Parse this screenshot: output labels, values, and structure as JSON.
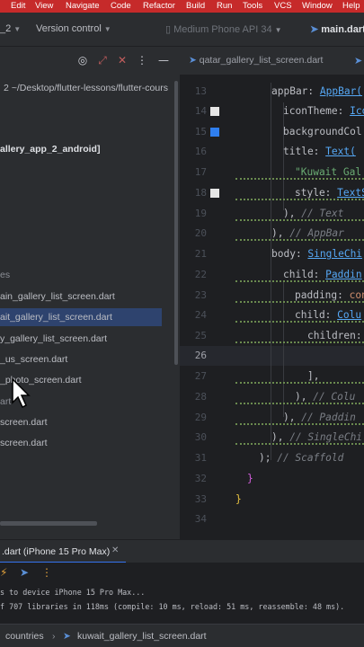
{
  "menubar": {
    "items": [
      "Edit",
      "View",
      "Navigate",
      "Code",
      "Refactor",
      "Build",
      "Run",
      "Tools",
      "VCS",
      "Window",
      "Help"
    ]
  },
  "toolbar": {
    "project_name": "_2",
    "vcs_label": "Version control",
    "device_label": "Medium Phone API 34",
    "run_config": "main.dart"
  },
  "editor_tabs": {
    "active_tab": "qatar_gallery_list_screen.dart"
  },
  "project_tree": {
    "rows": [
      {
        "text": "2  ~/Desktop/flutter-lessons/flutter-cours",
        "style": "normal"
      },
      {
        "text": "allery_app_2_android]",
        "style": "bold"
      },
      {
        "text": "es",
        "style": "muted"
      },
      {
        "text": "ain_gallery_list_screen.dart",
        "style": "normal"
      },
      {
        "text": "ait_gallery_list_screen.dart",
        "style": "selected"
      },
      {
        "text": "y_gallery_list_screen.dart",
        "style": "normal"
      },
      {
        "text": "_us_screen.dart",
        "style": "normal"
      },
      {
        "text": "_photo_screen.dart",
        "style": "normal"
      },
      {
        "text": "art",
        "style": "muted"
      },
      {
        "text": "screen.dart",
        "style": "normal"
      },
      {
        "text": "screen.dart",
        "style": "normal"
      }
    ]
  },
  "editor": {
    "line_numbers": [
      "13",
      "14",
      "15",
      "16",
      "17",
      "18",
      "19",
      "20",
      "21",
      "22",
      "23",
      "24",
      "25",
      "26",
      "27",
      "28",
      "29",
      "30",
      "31",
      "32",
      "33",
      "34"
    ],
    "active_line": "26",
    "code": {
      "l13": {
        "prop": "appBar: ",
        "cls": "AppBar("
      },
      "l14": {
        "prop": "iconTheme: ",
        "cls": "Ico"
      },
      "l15": {
        "prop": "backgroundCol"
      },
      "l16": {
        "prop": "title: ",
        "cls": "Text("
      },
      "l17": {
        "str": "\"Kuwait Gal"
      },
      "l18": {
        "prop": "style: ",
        "cls": "TextS"
      },
      "l19": {
        "pun": "),",
        "cmt": " // Text"
      },
      "l20": {
        "pun": "),",
        "cmt": " // AppBar"
      },
      "l21": {
        "prop": "body: ",
        "cls": "SingleChi"
      },
      "l22": {
        "prop": "child: ",
        "cls": "Paddin"
      },
      "l23": {
        "prop": "padding: ",
        "kw": "con"
      },
      "l24": {
        "prop": "child: ",
        "cls": "Colu"
      },
      "l25": {
        "prop": "children: ["
      },
      "l27": {
        "pun": "],"
      },
      "l28": {
        "pun": "),",
        "cmt": " // Colu"
      },
      "l29": {
        "pun": "),",
        "cmt": " // Paddin"
      },
      "l30": {
        "pun": "),",
        "cmt": " // SingleChi"
      },
      "l31": {
        "pun": ");",
        "cmt": " // Scaffold"
      },
      "l32": {
        "pun": "}"
      },
      "l33": {
        "pun": "}"
      }
    }
  },
  "run_panel": {
    "tab_label": ".dart (iPhone 15 Pro Max)",
    "console_lines": [
      "s to device iPhone 15 Pro Max...",
      "f 707 libraries in 118ms (compile: 10 ms, reload: 51 ms, reassemble: 48 ms)."
    ]
  },
  "status_bar": {
    "crumb_1": "countries",
    "crumb_2": "kuwait_gallery_list_screen.dart"
  },
  "colors": {
    "menubar_red": "#c62a2a",
    "selection_blue": "#2e436e",
    "keyword": "#cf8e6d",
    "class_blue": "#56a8f5",
    "string_green": "#6aab73",
    "comment_gray": "#7a7e85"
  },
  "icons": [
    "circle-target-icon",
    "expand-arrows-icon",
    "close-x-icon",
    "more-vertical-icon",
    "minimize-icon",
    "flutter-dart-icon",
    "dropdown-chevron-icon",
    "phone-icon",
    "play-icon",
    "bug-icon",
    "lightning-icon",
    "mouse-pointer-icon"
  ]
}
